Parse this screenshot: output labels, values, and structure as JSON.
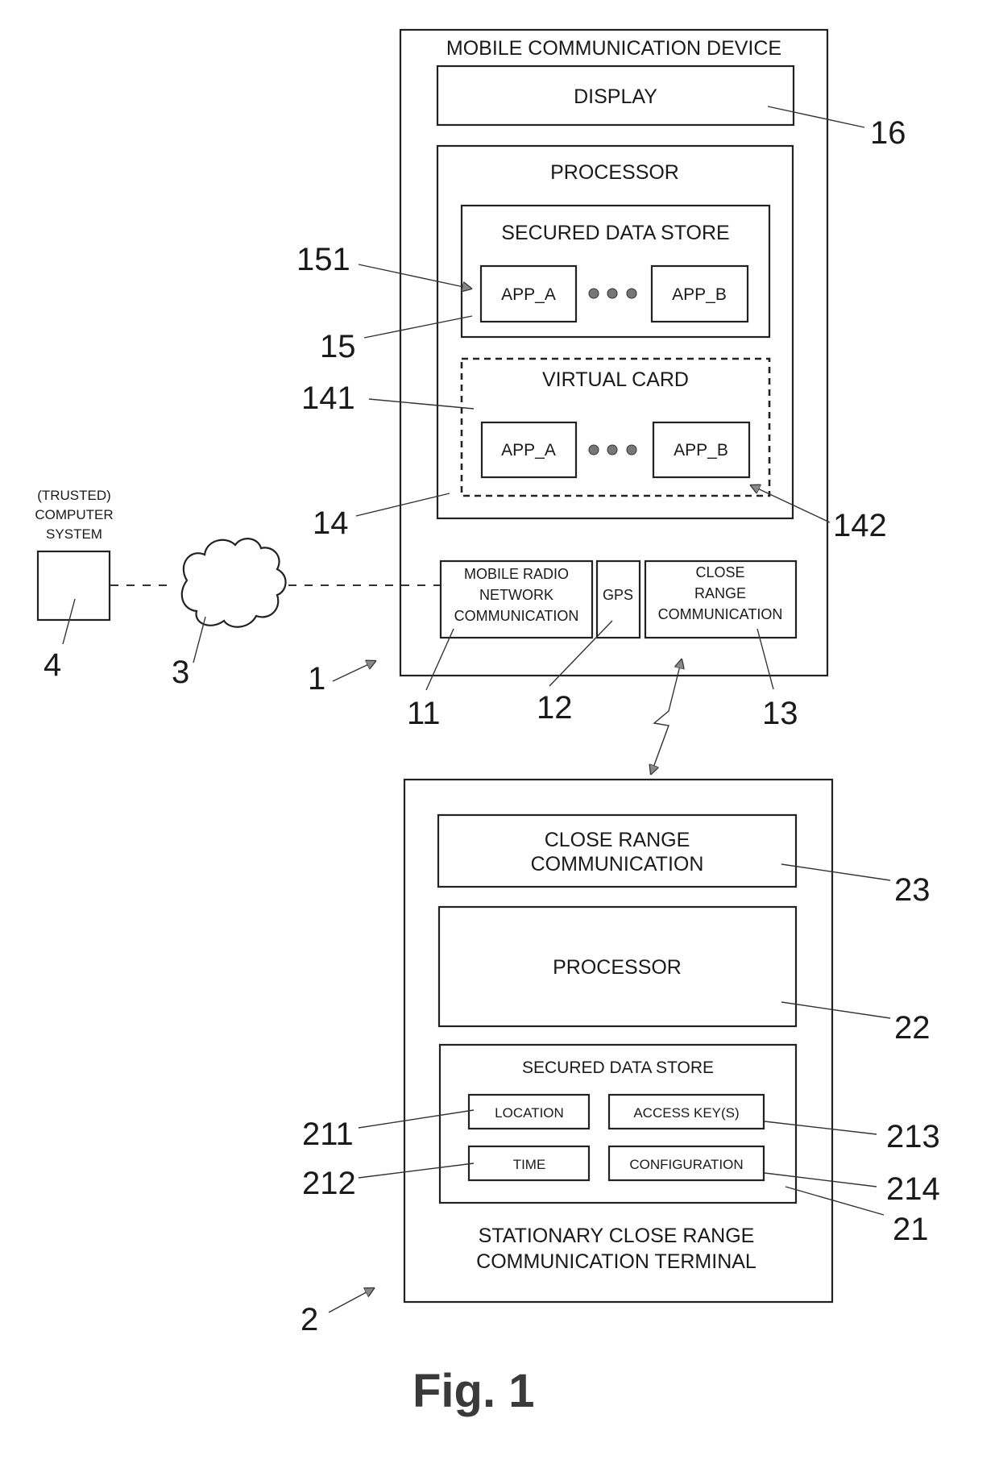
{
  "figure": {
    "caption": "Fig. 1"
  },
  "mobile_device": {
    "title": "MOBILE COMMUNICATION DEVICE",
    "ref": "1",
    "display": {
      "label": "DISPLAY",
      "ref": "16"
    },
    "processor": {
      "label": "PROCESSOR",
      "ref": "14",
      "secured_data_store": {
        "label": "SECURED DATA STORE",
        "ref": "15",
        "apps": [
          "APP_A",
          "APP_B"
        ],
        "app_ref": "151"
      },
      "virtual_card": {
        "label": "VIRTUAL CARD",
        "ref": "141",
        "apps": [
          "APP_A",
          "APP_B"
        ],
        "app_ref": "142"
      }
    },
    "modules": [
      {
        "label_lines": [
          "MOBILE RADIO",
          "NETWORK",
          "COMMUNICATION"
        ],
        "ref": "11"
      },
      {
        "label_lines": [
          "GPS"
        ],
        "ref": "12"
      },
      {
        "label_lines": [
          "CLOSE",
          "RANGE",
          "COMMUNICATION"
        ],
        "ref": "13"
      }
    ]
  },
  "network": {
    "ref": "3"
  },
  "computer_system": {
    "label_lines": [
      "(TRUSTED)",
      "COMPUTER",
      "SYSTEM"
    ],
    "ref": "4"
  },
  "terminal": {
    "title_lines": [
      "STATIONARY CLOSE RANGE",
      "COMMUNICATION TERMINAL"
    ],
    "ref": "2",
    "close_range": {
      "label_lines": [
        "CLOSE RANGE",
        "COMMUNICATION"
      ],
      "ref": "23"
    },
    "processor": {
      "label": "PROCESSOR",
      "ref": "22"
    },
    "secured_data_store": {
      "label": "SECURED DATA STORE",
      "ref": "21",
      "items": [
        {
          "label": "LOCATION",
          "ref": "211"
        },
        {
          "label": "TIME",
          "ref": "212"
        },
        {
          "label": "ACCESS KEY(S)",
          "ref": "213"
        },
        {
          "label": "CONFIGURATION",
          "ref": "214"
        }
      ]
    }
  }
}
